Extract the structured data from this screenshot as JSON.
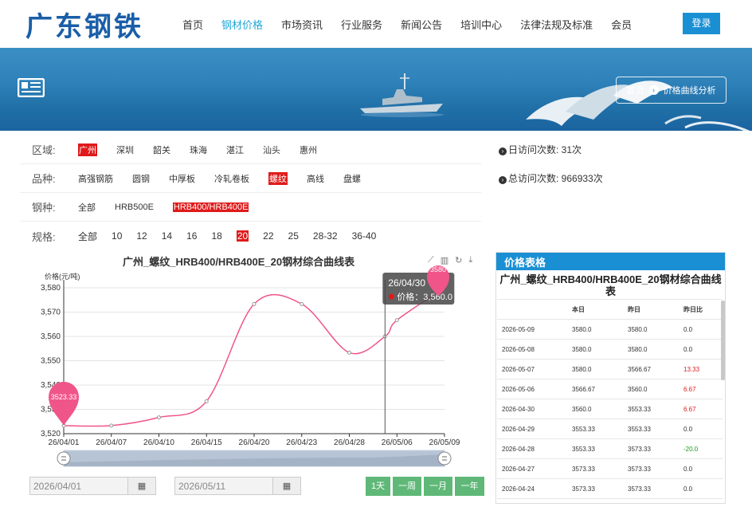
{
  "header": {
    "logo": "广东钢铁",
    "nav": [
      "首页",
      "钢材价格",
      "市场资讯",
      "行业服务",
      "新闻公告",
      "培训中心",
      "法律法规及标准",
      "会员"
    ],
    "active_nav": 1,
    "login": "登录"
  },
  "banner": {
    "breadcrumb_home": "首页",
    "breadcrumb_current": "价格曲线分析",
    "arrow": "›"
  },
  "filters": {
    "region": {
      "label": "区域:",
      "options": [
        "广州",
        "深圳",
        "韶关",
        "珠海",
        "湛江",
        "汕头",
        "惠州"
      ],
      "selected": 0
    },
    "variety": {
      "label": "品种:",
      "options": [
        "高强钢筋",
        "圆钢",
        "中厚板",
        "冷轧卷板",
        "螺纹",
        "高线",
        "盘螺"
      ],
      "selected": 4
    },
    "grade": {
      "label": "钢种:",
      "options": [
        "全部",
        "HRB500E",
        "HRB400/HRB400E"
      ],
      "selected": 2
    },
    "spec": {
      "label": "规格:",
      "options": [
        "全部",
        "10",
        "12",
        "14",
        "16",
        "18",
        "20",
        "22",
        "25",
        "28-32",
        "36-40"
      ],
      "selected": 6
    }
  },
  "visits": {
    "daily": "日访问次数: 31次",
    "total": "总访问次数: 966933次"
  },
  "chart_data": {
    "type": "line",
    "title": "广州_螺纹_HRB400/HRB400E_20钢材综合曲线表",
    "ylabel": "价格(元/吨)",
    "ylim": [
      3520,
      3580
    ],
    "yticks": [
      3520,
      3530,
      3540,
      3550,
      3560,
      3570,
      3580
    ],
    "ytick_labels": [
      "3,520",
      "3,530",
      "3,540",
      "3,550",
      "3,560",
      "3,570",
      "3,580"
    ],
    "xticks": [
      "26/04/01",
      "26/04/07",
      "26/04/10",
      "26/04/15",
      "26/04/20",
      "26/04/23",
      "26/04/28",
      "26/05/06",
      "26/05/09"
    ],
    "points": [
      {
        "x": 0,
        "y": 3523.33
      },
      {
        "x": 1,
        "y": 3523.33
      },
      {
        "x": 2,
        "y": 3526.67
      },
      {
        "x": 3,
        "y": 3533.33
      },
      {
        "x": 4,
        "y": 3573.33
      },
      {
        "x": 5,
        "y": 3573.33
      },
      {
        "x": 6,
        "y": 3553.33
      },
      {
        "x": 6.75,
        "y": 3560
      },
      {
        "x": 7,
        "y": 3566.67
      },
      {
        "x": 8,
        "y": 3580
      }
    ],
    "min_marker": "3523.33",
    "max_marker": "3580",
    "tooltip": {
      "date": "26/04/30",
      "label": "价格：3,560.0"
    },
    "color": "#f0558a"
  },
  "date_range": {
    "start": "2026/04/01",
    "end": "2026/05/11"
  },
  "range_buttons": [
    "1天",
    "一周",
    "一月",
    "一年"
  ],
  "price_table": {
    "header": "价格表格",
    "title": "广州_螺纹_HRB400/HRB400E_20钢材综合曲线表",
    "columns": [
      "",
      "本日",
      "昨日",
      "昨日比"
    ],
    "rows": [
      [
        "2026-05-09",
        "3580.0",
        "3580.0",
        "0.0"
      ],
      [
        "2026-05-08",
        "3580.0",
        "3580.0",
        "0.0"
      ],
      [
        "2026-05-07",
        "3580.0",
        "3566.67",
        "13.33"
      ],
      [
        "2026-05-06",
        "3566.67",
        "3560.0",
        "6.67"
      ],
      [
        "2026-04-30",
        "3560.0",
        "3553.33",
        "6.67"
      ],
      [
        "2026-04-29",
        "3553.33",
        "3553.33",
        "0.0"
      ],
      [
        "2026-04-28",
        "3553.33",
        "3573.33",
        "-20.0"
      ],
      [
        "2026-04-27",
        "3573.33",
        "3573.33",
        "0.0"
      ],
      [
        "2026-04-24",
        "3573.33",
        "3573.33",
        "0.0"
      ]
    ]
  }
}
